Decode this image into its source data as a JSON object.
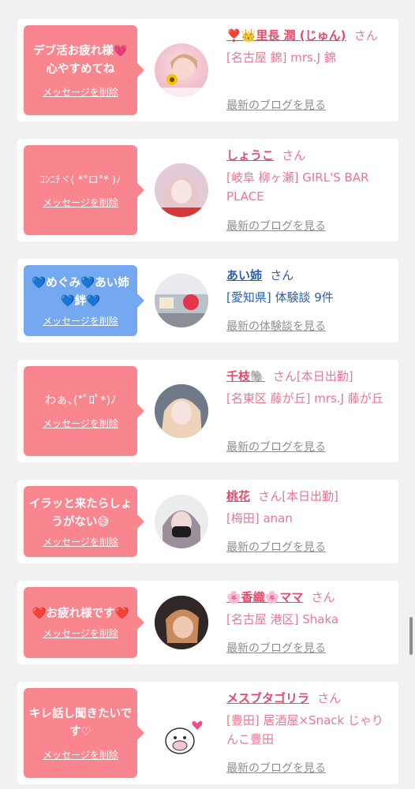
{
  "cards": [
    {
      "bubble": {
        "text": "デブ活お疲れ様💗心やすめてね",
        "delete": "メッセージを削除",
        "color": "#f9868e"
      },
      "name": "❣️👑里長 潤 (じゅん)",
      "san": "さん",
      "detail": "[名古屋 錦] mrs.J 錦",
      "link": "最新のブログを見る",
      "avatar": "girl-with-sunflower-avatar"
    },
    {
      "bubble": {
        "text": "ｺﾝﾆﾁヾ( *°ロ°* )ﾉ",
        "delete": "メッセージを削除",
        "color": "#f9868e"
      },
      "name": "しょうこ",
      "san": "さん",
      "detail": "[岐阜 柳ヶ瀬] GIRL'S BAR PLACE",
      "link": "最新のブログを見る",
      "avatar": "girl-with-ears-avatar"
    },
    {
      "bubble": {
        "text": "💙めぐみ💙あい姉💙絆💙",
        "delete": "メッセージを削除",
        "color": "#74a8f0"
      },
      "name": "あい姉",
      "san": "さん",
      "detail": "[愛知県] 体験談 9件",
      "link": "最新の体験談を見る",
      "avatar": "photo-avatar"
    },
    {
      "bubble": {
        "text": "わぁ､(*ﾟﾛﾟ*)ﾉ",
        "delete": "メッセージを削除",
        "color": "#f9868e"
      },
      "name": "千枝🐘",
      "san": "さん[本日出勤]",
      "detail": "[名東区 藤が丘] mrs.J 藤が丘",
      "link": "最新のブログを見る",
      "avatar": "blonde-girl-avatar"
    },
    {
      "bubble": {
        "text": "イラッと来たらしょうがない😅",
        "delete": "メッセージを削除",
        "color": "#f9868e"
      },
      "name": "桃花",
      "san": "さん[本日出勤]",
      "detail": "[梅田] anan",
      "link": "最新のブログを見る",
      "avatar": "masked-girl-avatar"
    },
    {
      "bubble": {
        "text": "❤️お疲れ様です❤️",
        "delete": "メッセージを削除",
        "color": "#f9868e"
      },
      "name": "🌸香織🌸ママ",
      "san": "さん",
      "detail": "[名古屋 港区] Shaka",
      "link": "最新のブログを見る",
      "avatar": "selfie-avatar"
    },
    {
      "bubble": {
        "text": "キレ話し聞きたいです♡",
        "delete": "メッセージを削除",
        "color": "#f9868e"
      },
      "name": "メスブタゴリラ",
      "san": "さん",
      "detail": "[豊田] 居酒屋×Snack じゃりんこ豊田",
      "link": "最新のブログを見る",
      "avatar": "gorilla-illustration-avatar"
    }
  ]
}
